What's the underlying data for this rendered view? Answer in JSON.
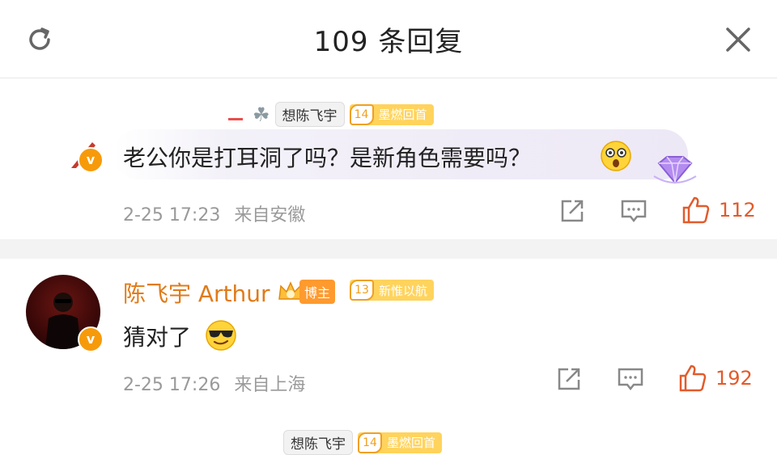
{
  "header": {
    "title": "109 条回复"
  },
  "comments": [
    {
      "reply_to_user": "想陈飞宇",
      "reply_to_level": "14",
      "reply_to_tag": "墨燃回首",
      "text": "老公你是打耳洞了吗？是新角色需要吗？",
      "timestamp": "2-25 17:23",
      "location": "来自安徽",
      "likes": "112"
    },
    {
      "username": "陈飞宇 Arthur",
      "host_label": "博主",
      "level": "13",
      "level_tag": "新惟以航",
      "text": "猜对了",
      "timestamp": "2-25 17:26",
      "location": "来自上海",
      "likes": "192"
    }
  ],
  "next_preview": {
    "reply_to_user": "想陈飞宇",
    "reply_to_level": "14",
    "reply_to_tag": "墨燃回首"
  },
  "colors": {
    "accent": "#e07b1a",
    "like": "#e25b2b",
    "meta": "#9a9a9a"
  }
}
